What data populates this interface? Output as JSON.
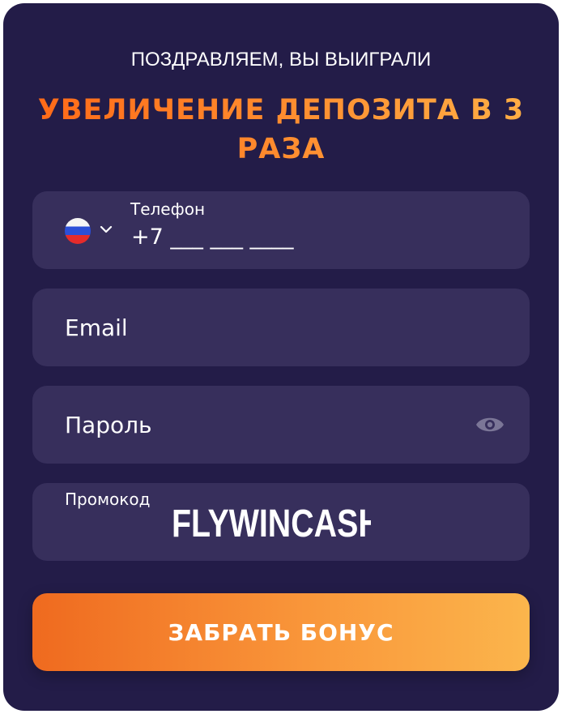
{
  "header": {
    "subtitle": "ПОЗДРАВЛЯЕМ, ВЫ ВЫИГРАЛИ",
    "headline": "УВЕЛИЧЕНИЕ ДЕПОЗИТА В 3 РАЗА"
  },
  "form": {
    "phone": {
      "label": "Телефон",
      "placeholder": "+7 ___ ___ ____",
      "country_icon": "russia-flag-icon"
    },
    "email": {
      "placeholder": "Email"
    },
    "password": {
      "placeholder": "Пароль",
      "toggle_icon": "eye-icon"
    },
    "promo": {
      "label": "Промокод",
      "value": "FLYWINCASH"
    }
  },
  "submit": {
    "label": "ЗАБРАТЬ БОНУС"
  },
  "colors": {
    "background": "#231c48",
    "field": "#372f5c",
    "accent_start": "#ef6a1f",
    "accent_end": "#fbb54c"
  }
}
